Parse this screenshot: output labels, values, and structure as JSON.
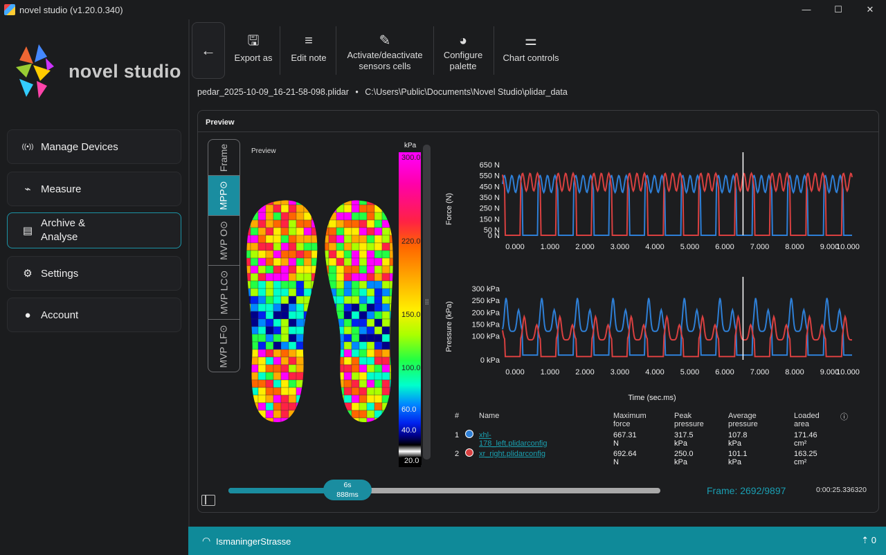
{
  "window": {
    "title": "novel studio (v1.20.0.340)",
    "min": "—",
    "max": "☐",
    "close": "✕"
  },
  "brand": "novel studio",
  "nav": [
    {
      "label": "Manage Devices",
      "icon": "((•))"
    },
    {
      "label": "Measure",
      "icon": "⌁"
    },
    {
      "label": "Archive &\nAnalyse",
      "icon": "▤"
    },
    {
      "label": "Settings",
      "icon": "⚙"
    },
    {
      "label": "Account",
      "icon": "●"
    }
  ],
  "toolbar": {
    "back": "←",
    "buttons": [
      {
        "label": "Export as",
        "icon": "🖫"
      },
      {
        "label": "Edit note",
        "icon": "≡"
      },
      {
        "label": "Activate/deactivate\nsensors cells",
        "icon": "✎"
      },
      {
        "label": "Configure\npalette",
        "icon": "◕"
      },
      {
        "label": "Chart controls",
        "icon": "⚌"
      }
    ]
  },
  "file": {
    "name": "pedar_2025-10-09_16-21-58-098.plidar",
    "sep": "•",
    "path": "C:\\Users\\Public\\Documents\\Novel Studio\\plidar_data"
  },
  "panel": {
    "title": "Preview",
    "preview_label": "Preview"
  },
  "vtabs": [
    "Frame",
    "MPP⊙",
    "MVP O⊙",
    "MVP LC⊙",
    "MVP LF⊙"
  ],
  "scale": {
    "unit": "kPa",
    "labels": [
      "300.0",
      "220.0",
      "150.0",
      "100.0",
      "60.0",
      "40.0",
      "20.0"
    ]
  },
  "force_chart": {
    "ylabel": "Force (N)",
    "yticks": [
      "650 N",
      "550 N",
      "450 N",
      "350 N",
      "250 N",
      "150 N",
      "50 N",
      "0 N"
    ],
    "xticks": [
      "0.000",
      "1.000",
      "2.000",
      "3.000",
      "4.000",
      "5.000",
      "6.000",
      "7.000",
      "8.000",
      "9.000",
      "10.000"
    ]
  },
  "pressure_chart": {
    "ylabel": "Pressure (kPa)",
    "yticks": [
      "300 kPa",
      "250 kPa",
      "200 kPa",
      "150 kPa",
      "100 kPa",
      "0 kPa"
    ],
    "xticks": [
      "0.000",
      "1.000",
      "2.000",
      "3.000",
      "4.000",
      "5.000",
      "6.000",
      "7.000",
      "8.000",
      "9.000",
      "10.000"
    ]
  },
  "xaxis_label": "Time (sec.ms)",
  "chart_data": [
    {
      "type": "line",
      "ylabel": "Force (N)",
      "xlabel": "Time (sec.ms)",
      "xlim": [
        0,
        10
      ],
      "ylim": [
        0,
        700
      ],
      "cursor_x": 6.88,
      "series": [
        {
          "name": "xhl-178_left.plidarconfig",
          "color": "#2e7fd6"
        },
        {
          "name": "xr_right.plidarconfig",
          "color": "#d94040"
        }
      ]
    },
    {
      "type": "line",
      "ylabel": "Pressure (kPa)",
      "xlabel": "Time (sec.ms)",
      "xlim": [
        0,
        10
      ],
      "ylim": [
        0,
        320
      ],
      "cursor_x": 6.88,
      "series": [
        {
          "name": "xhl-178_left.plidarconfig",
          "color": "#2e7fd6"
        },
        {
          "name": "xr_right.plidarconfig",
          "color": "#d94040"
        }
      ]
    }
  ],
  "table": {
    "headers": [
      "#",
      "Name",
      "Maximum force",
      "Peak pressure",
      "Average pressure",
      "Loaded area"
    ],
    "info": "ⓘ",
    "rows": [
      {
        "n": "1",
        "name": "xhl-178_left.plidarconfig",
        "color": "#2e7fd6",
        "force": "667.31 N",
        "peak": "317.5 kPa",
        "avg": "107.8 kPa",
        "area": "171.46 cm²"
      },
      {
        "n": "2",
        "name": "xr_right.plidarconfig",
        "color": "#d94040",
        "force": "692.64 N",
        "peak": "250.0 kPa",
        "avg": "101.1 kPa",
        "area": "163.25 cm²"
      }
    ]
  },
  "slider": {
    "line1": "6s",
    "line2": "888ms",
    "progress": 0.24
  },
  "frame": "Frame: 2692/9897",
  "time": "0:00:25.336320",
  "footer": {
    "network": "IsmaningerStrasse",
    "usb": "0"
  }
}
